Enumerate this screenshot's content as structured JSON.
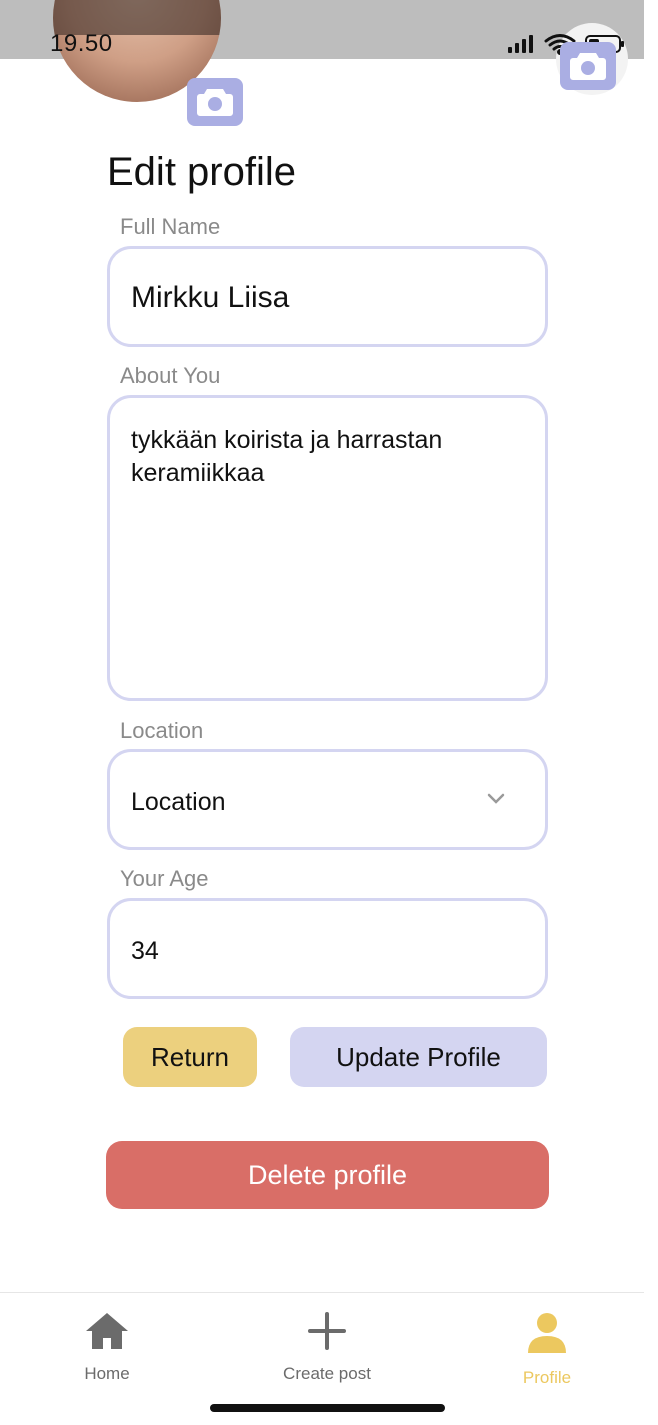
{
  "status_bar": {
    "time": "19.50"
  },
  "page": {
    "title": "Edit profile"
  },
  "form": {
    "full_name": {
      "label": "Full Name",
      "value": "Mirkku Liisa"
    },
    "about": {
      "label": "About You",
      "value_line1": "tykkään koirista ja harrastan",
      "value_line2": "keramiikkaa"
    },
    "location": {
      "label": "Location",
      "value": "Location"
    },
    "age": {
      "label": "Your Age",
      "value": "34"
    }
  },
  "actions": {
    "return_label": "Return",
    "update_label": "Update Profile",
    "delete_label": "Delete profile"
  },
  "tabbar": {
    "home_label": "Home",
    "create_label": "Create post",
    "profile_label": "Profile"
  },
  "colors": {
    "accent_purple": "#aaaee3",
    "field_border": "#d4d5f1",
    "return_button": "#ecd07e",
    "update_button": "#d4d5f1",
    "delete_button": "#d96e67",
    "active_tab": "#ecc85f",
    "inactive_tab": "#6b6b6b"
  },
  "icons": [
    "camera-icon",
    "signal-icon",
    "wifi-icon",
    "battery-icon",
    "chevron-down-icon",
    "home-icon",
    "plus-icon",
    "person-icon"
  ]
}
